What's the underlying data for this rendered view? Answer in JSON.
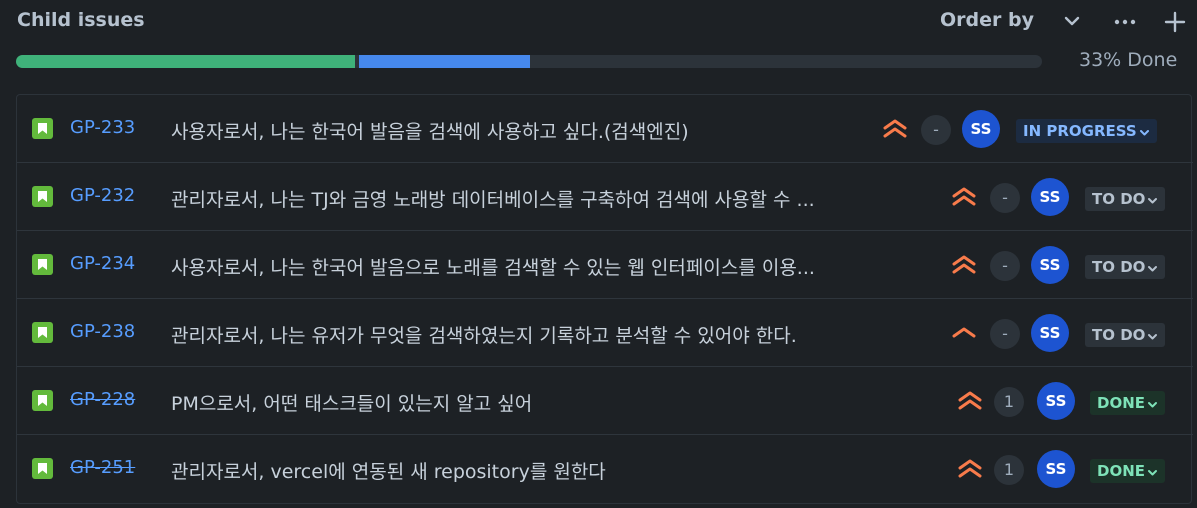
{
  "header": {
    "title": "Child issues",
    "order_by_label": "Order by",
    "icons": [
      "chevron-down-icon",
      "more-icon",
      "plus-icon"
    ]
  },
  "progress": {
    "percent_label": "33% Done",
    "done_fraction": 0.33,
    "in_progress_fraction": 0.17,
    "colors": {
      "done": "#3fb27a",
      "in_progress": "#4688ec",
      "todo": "#2c333a"
    }
  },
  "issues": [
    {
      "key": "GP-233",
      "summary": "사용자로서, 나는 한국어 발음을 검색에 사용하고 싶다.(검색엔진)",
      "priority": "high",
      "estimate": "-",
      "assignee": "SS",
      "status": "IN PROGRESS",
      "resolved": false
    },
    {
      "key": "GP-232",
      "summary": "관리자로서, 나는 TJ와 금영 노래방 데이터베이스를 구축하여 검색에 사용할 수 ...",
      "priority": "high",
      "estimate": "-",
      "assignee": "SS",
      "status": "TO DO",
      "resolved": false
    },
    {
      "key": "GP-234",
      "summary": "사용자로서, 나는 한국어 발음으로 노래를 검색할 수 있는 웹 인터페이스를 이용...",
      "priority": "high",
      "estimate": "-",
      "assignee": "SS",
      "status": "TO DO",
      "resolved": false
    },
    {
      "key": "GP-238",
      "summary": "관리자로서, 나는 유저가 무엇을 검색하였는지 기록하고 분석할 수 있어야 한다.",
      "priority": "medium",
      "estimate": "-",
      "assignee": "SS",
      "status": "TO DO",
      "resolved": false
    },
    {
      "key": "GP-228",
      "summary": "PM으로서, 어떤 태스크들이 있는지 알고 싶어",
      "priority": "high",
      "estimate": "1",
      "assignee": "SS",
      "status": "DONE",
      "resolved": true
    },
    {
      "key": "GP-251",
      "summary": "관리자로서, vercel에 연동된 새 repository를 원한다",
      "priority": "high",
      "estimate": "1",
      "assignee": "SS",
      "status": "DONE",
      "resolved": true
    }
  ]
}
